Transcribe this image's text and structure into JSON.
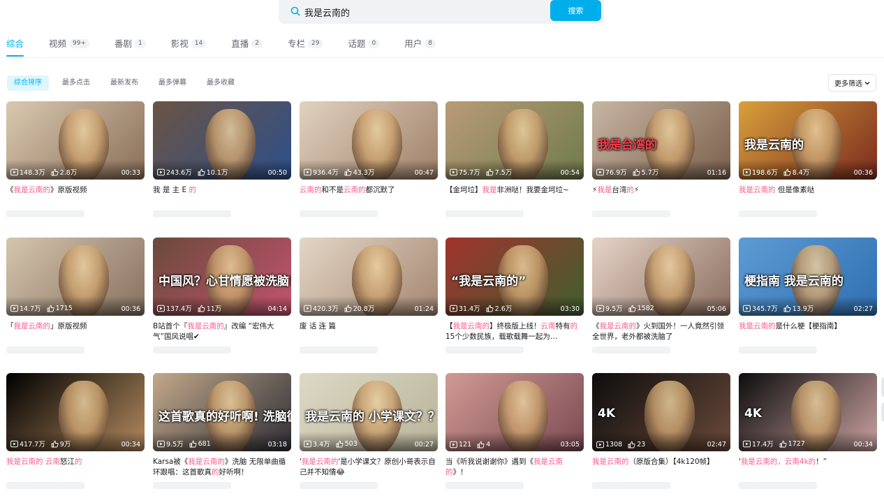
{
  "search": {
    "query": "我是云南的",
    "button_label": "搜索"
  },
  "tabs": [
    {
      "label": "综合",
      "badge": "",
      "active": true
    },
    {
      "label": "视频",
      "badge": "99+"
    },
    {
      "label": "番剧",
      "badge": "1"
    },
    {
      "label": "影视",
      "badge": "14"
    },
    {
      "label": "直播",
      "badge": "2"
    },
    {
      "label": "专栏",
      "badge": "29"
    },
    {
      "label": "话题",
      "badge": "0"
    },
    {
      "label": "用户",
      "badge": "8"
    }
  ],
  "sorts": [
    {
      "label": "综合排序",
      "active": true
    },
    {
      "label": "最多点击"
    },
    {
      "label": "最新发布"
    },
    {
      "label": "最多弹幕"
    },
    {
      "label": "最多收藏"
    }
  ],
  "more_filter_label": "更多筛选",
  "colors": {
    "accent": "#00aeec",
    "highlight": "#f25d8e"
  },
  "videos": [
    {
      "plays": "148.3万",
      "likes": "2.8万",
      "duration": "00:33",
      "title": [
        {
          "t": "《"
        },
        {
          "t": "我是云南的",
          "h": true
        },
        {
          "t": "》原版视频"
        }
      ],
      "bg": [
        "#d9c9b0",
        "#8a6e58"
      ],
      "overlay": ""
    },
    {
      "plays": "243.6万",
      "likes": "10.1万",
      "duration": "00:50",
      "title": [
        {
          "t": "我 是 主 E "
        },
        {
          "t": "的",
          "h": true
        }
      ],
      "bg": [
        "#6b5444",
        "#2d4f8a"
      ],
      "overlay": ""
    },
    {
      "plays": "936.4万",
      "likes": "43.3万",
      "duration": "00:47",
      "title": [
        {
          "t": "云南的",
          "h": true
        },
        {
          "t": "和不是"
        },
        {
          "t": "云南的",
          "h": true
        },
        {
          "t": "都沉默了"
        }
      ],
      "bg": [
        "#e0d2c0",
        "#a08068"
      ],
      "overlay": ""
    },
    {
      "plays": "75.7万",
      "likes": "7.5万",
      "duration": "00:54",
      "title": [
        {
          "t": "【金坷垃】"
        },
        {
          "t": "我是",
          "h": true
        },
        {
          "t": "非洲哒！我要金坷垃~"
        }
      ],
      "bg": [
        "#b99b78",
        "#6f7b4a"
      ],
      "overlay": ""
    },
    {
      "plays": "76.9万",
      "likes": "5.7万",
      "duration": "01:16",
      "title": [
        {
          "t": "⚡"
        },
        {
          "t": "我是",
          "h": true
        },
        {
          "t": "台湾"
        },
        {
          "t": "的",
          "h": true
        },
        {
          "t": "⚡"
        }
      ],
      "bg": [
        "#c7b6a2",
        "#7a5f4c"
      ],
      "overlay": "我是台湾的"
    },
    {
      "plays": "198.6万",
      "likes": "8.4万",
      "duration": "00:36",
      "title": [
        {
          "t": "我是云南的",
          "h": true
        },
        {
          "t": " 但是像素哒"
        }
      ],
      "bg": [
        "#d8a03b",
        "#7b2a1e"
      ],
      "overlay": "我是云南的"
    },
    {
      "plays": "14.7万",
      "likes": "1715",
      "duration": "00:36",
      "title": [
        {
          "t": "「"
        },
        {
          "t": "我是云南的",
          "h": true
        },
        {
          "t": "」原版视频"
        }
      ],
      "bg": [
        "#d5c5ae",
        "#86705e"
      ],
      "overlay": ""
    },
    {
      "plays": "137.4万",
      "likes": "11万",
      "duration": "04:14",
      "title": [
        {
          "t": "B站首个『"
        },
        {
          "t": "我是云南的",
          "h": true
        },
        {
          "t": "』改编 “宏伟大气”国风说唱✔"
        }
      ],
      "bg": [
        "#6a4a3b",
        "#c4536e"
      ],
      "overlay": "中国风？心甘情愿被洗脑！"
    },
    {
      "plays": "420.3万",
      "likes": "20.8万",
      "duration": "01:24",
      "title": [
        {
          "t": "废 话 连 篇"
        }
      ],
      "bg": [
        "#e3d6c6",
        "#a48670"
      ],
      "overlay": ""
    },
    {
      "plays": "31.4万",
      "likes": "2.6万",
      "duration": "03:30",
      "title": [
        {
          "t": "【"
        },
        {
          "t": "我是云南的",
          "h": true
        },
        {
          "t": "】终极版上线！"
        },
        {
          "t": "云南",
          "h": true
        },
        {
          "t": "特有"
        },
        {
          "t": "的",
          "h": true
        },
        {
          "t": "15个少数民族，载歌载舞一起为…"
        }
      ],
      "bg": [
        "#a2332d",
        "#3f5f2f"
      ],
      "overlay": "“我是云南的”"
    },
    {
      "plays": "9.5万",
      "likes": "1582",
      "duration": "05:06",
      "title": [
        {
          "t": "《"
        },
        {
          "t": "我是云南的",
          "h": true
        },
        {
          "t": "》火到国外！一人竟然引领全世界，老外都被洗脑了"
        }
      ],
      "bg": [
        "#e6d3c8",
        "#8a6e5f"
      ],
      "overlay": ""
    },
    {
      "plays": "345.7万",
      "likes": "13.9万",
      "duration": "02:27",
      "title": [
        {
          "t": "我是云南的",
          "h": true
        },
        {
          "t": "是什么梗【梗指南】"
        }
      ],
      "bg": [
        "#5d9bd4",
        "#2f6fb0"
      ],
      "overlay": "梗指南 我是云南的"
    },
    {
      "plays": "417.7万",
      "likes": "9万",
      "duration": "00:34",
      "title": [
        {
          "t": "我是云南的 云南",
          "h": true
        },
        {
          "t": "怒江"
        },
        {
          "t": "的",
          "h": true
        }
      ],
      "bg": [
        "#000000",
        "#b48b60"
      ],
      "overlay": ""
    },
    {
      "plays": "9.5万",
      "likes": "681",
      "duration": "03:18",
      "title": [
        {
          "t": "Karsa被《"
        },
        {
          "t": "我是云南的",
          "h": true
        },
        {
          "t": "》洗脑 无限单曲循环跟唱：这首歌真"
        },
        {
          "t": "的",
          "h": true
        },
        {
          "t": "好听啊！"
        }
      ],
      "bg": [
        "#c2a88a",
        "#2e2e36"
      ],
      "overlay": "这首歌真的好听啊! 洗脑循环!"
    },
    {
      "plays": "3.4万",
      "likes": "503",
      "duration": "00:27",
      "title": [
        {
          "t": "'"
        },
        {
          "t": "我是云南的",
          "h": true
        },
        {
          "t": "'是小学课文？原创小哥表示自己并不知情😂"
        }
      ],
      "bg": [
        "#dcd8c4",
        "#b9b49a"
      ],
      "overlay": "我是云南的 小学课文？？？"
    },
    {
      "plays": "121",
      "likes": "4",
      "duration": "03:05",
      "title": [
        {
          "t": "当《听我说谢谢你》遇到《"
        },
        {
          "t": "我是云南的",
          "h": true
        },
        {
          "t": "》！"
        }
      ],
      "bg": [
        "#d09a94",
        "#7b4a52"
      ],
      "overlay": ""
    },
    {
      "plays": "1308",
      "likes": "23",
      "duration": "02:47",
      "title": [
        {
          "t": "我是云南的",
          "h": true
        },
        {
          "t": "（原版合集）【4k120帧】"
        }
      ],
      "bg": [
        "#0d0d0d",
        "#6b4a3a"
      ],
      "overlay": "4K"
    },
    {
      "plays": "17.4万",
      "likes": "1727",
      "duration": "00:34",
      "title": [
        {
          "t": "'"
        },
        {
          "t": "我是云南的，云南4k的",
          "h": true
        },
        {
          "t": "！”"
        }
      ],
      "bg": [
        "#0d0d0d",
        "#c9a2a0"
      ],
      "overlay": "4K"
    }
  ]
}
